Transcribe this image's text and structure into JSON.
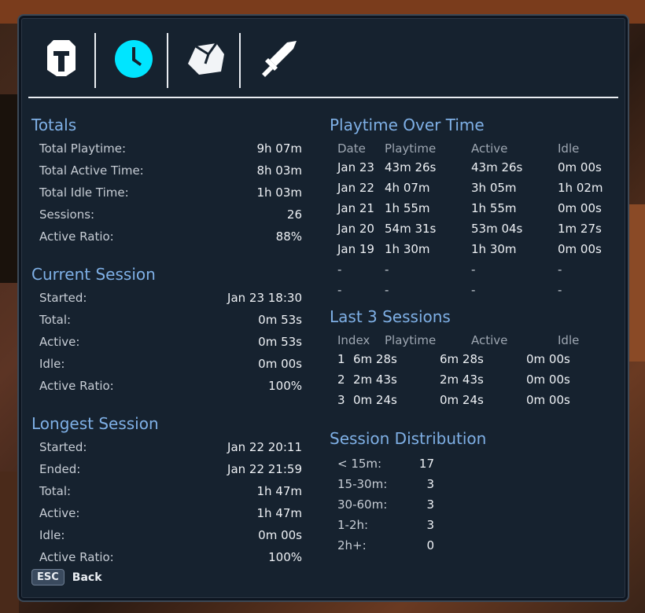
{
  "tabs": [
    {
      "icon": "helmet-icon",
      "active": false
    },
    {
      "icon": "clock-icon",
      "active": true
    },
    {
      "icon": "stone-icon",
      "active": false
    },
    {
      "icon": "sword-icon",
      "active": false
    }
  ],
  "totals": {
    "title": "Totals",
    "rows": [
      {
        "label": "Total Playtime:",
        "value": "9h 07m"
      },
      {
        "label": "Total Active Time:",
        "value": "8h 03m"
      },
      {
        "label": "Total Idle Time:",
        "value": "1h 03m"
      },
      {
        "label": "Sessions:",
        "value": "26"
      },
      {
        "label": "Active Ratio:",
        "value": "88%"
      }
    ]
  },
  "current_session": {
    "title": "Current Session",
    "rows": [
      {
        "label": "Started:",
        "value": "Jan 23 18:30"
      },
      {
        "label": "Total:",
        "value": "0m 53s"
      },
      {
        "label": "Active:",
        "value": "0m 53s"
      },
      {
        "label": "Idle:",
        "value": "0m 00s"
      },
      {
        "label": "Active Ratio:",
        "value": "100%"
      }
    ]
  },
  "longest_session": {
    "title": "Longest Session",
    "rows": [
      {
        "label": "Started:",
        "value": "Jan 22 20:11"
      },
      {
        "label": "Ended:",
        "value": "Jan 22 21:59"
      },
      {
        "label": "Total:",
        "value": "1h 47m"
      },
      {
        "label": "Active:",
        "value": "1h 47m"
      },
      {
        "label": "Idle:",
        "value": "0m 00s"
      },
      {
        "label": "Active Ratio:",
        "value": "100%"
      }
    ]
  },
  "playtime_over_time": {
    "title": "Playtime Over Time",
    "headers": [
      "Date",
      "Playtime",
      "Active",
      "Idle"
    ],
    "rows": [
      [
        "Jan 23",
        "43m 26s",
        "43m 26s",
        "0m 00s"
      ],
      [
        "Jan 22",
        "4h 07m",
        "3h 05m",
        "1h 02m"
      ],
      [
        "Jan 21",
        "1h 55m",
        "1h 55m",
        "0m 00s"
      ],
      [
        "Jan 20",
        "54m 31s",
        "53m 04s",
        "1m 27s"
      ],
      [
        "Jan 19",
        "1h 30m",
        "1h 30m",
        "0m 00s"
      ],
      [
        "-",
        "-",
        "-",
        "-"
      ],
      [
        "-",
        "-",
        "-",
        "-"
      ]
    ]
  },
  "last_sessions": {
    "title": "Last 3 Sessions",
    "headers": [
      "Index",
      "Playtime",
      "Active",
      "Idle"
    ],
    "rows": [
      [
        "1",
        "6m 28s",
        "6m 28s",
        "0m 00s"
      ],
      [
        "2",
        "2m 43s",
        "2m 43s",
        "0m 00s"
      ],
      [
        "3",
        "0m 24s",
        "0m 24s",
        "0m 00s"
      ]
    ]
  },
  "distribution": {
    "title": "Session Distribution",
    "rows": [
      {
        "label": "< 15m:",
        "value": "17"
      },
      {
        "label": "15-30m:",
        "value": "3"
      },
      {
        "label": "30-60m:",
        "value": "3"
      },
      {
        "label": "1-2h:",
        "value": "3"
      },
      {
        "label": "2h+:",
        "value": "0"
      }
    ]
  },
  "footer": {
    "key": "ESC",
    "label": "Back"
  },
  "colors": {
    "accent": "#00e5ff",
    "section_title": "#7fb0e6",
    "panel": "#16222f"
  }
}
